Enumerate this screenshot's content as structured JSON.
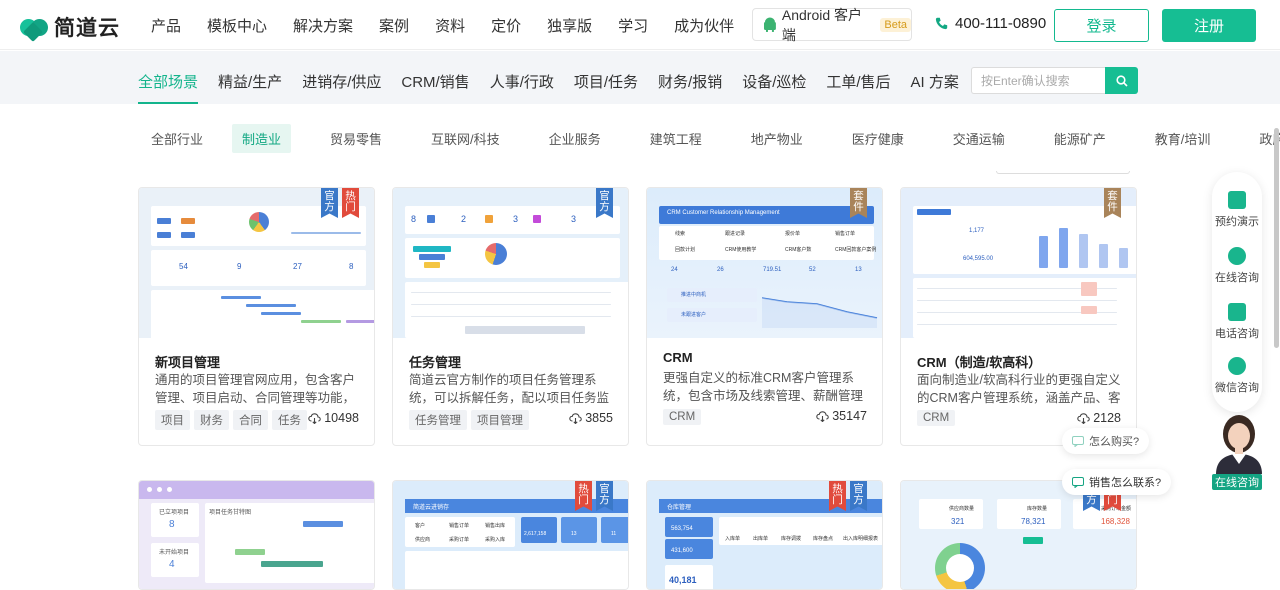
{
  "brand": {
    "name": "简道云"
  },
  "nav": {
    "links": [
      "产品",
      "模板中心",
      "解决方案",
      "案例",
      "资料",
      "定价",
      "独享版",
      "学习",
      "成为伙伴"
    ],
    "android_label": "Android 客户端",
    "beta": "Beta",
    "phone": "400-111-0890",
    "login": "登录",
    "signup": "注册"
  },
  "scenes": {
    "items": [
      "全部场景",
      "精益/生产",
      "进销存/供应",
      "CRM/销售",
      "人事/行政",
      "项目/任务",
      "财务/报销",
      "设备/巡检",
      "工单/售后",
      "AI 方案"
    ],
    "active_index": 0
  },
  "search": {
    "placeholder": "按Enter确认搜索",
    "value": ""
  },
  "industries": {
    "items": [
      "全部行业",
      "制造业",
      "贸易零售",
      "互联网/科技",
      "企业服务",
      "建筑工程",
      "地产物业",
      "医疗健康",
      "交通运输",
      "能源矿产",
      "教育/培训",
      "政府/公益"
    ],
    "active_index": 1
  },
  "cards": [
    {
      "title": "新项目管理",
      "desc": "通用的项目管理官网应用，包含客户管理、项目启动、合同管理等功能，让…",
      "tags": [
        "项目",
        "财务",
        "合同",
        "任务"
      ],
      "views": "10498",
      "ribbons": [
        "官方",
        "热门"
      ]
    },
    {
      "title": "任务管理",
      "desc": "简道云官方制作的项目任务管理系统，可以拆解任务，配以项目任务监控看…",
      "tags": [
        "任务管理",
        "项目管理"
      ],
      "views": "3855",
      "ribbons": [
        "官方"
      ]
    },
    {
      "title": "CRM",
      "desc": "更强自定义的标准CRM客户管理系统，包含市场及线索管理、薪酬管理等功能",
      "tags": [
        "CRM"
      ],
      "views": "35147",
      "ribbons": [
        "套件"
      ]
    },
    {
      "title": "CRM（制造/软高科）",
      "desc": "面向制造业/软高科行业的更强自定义的CRM客户管理系统，涵盖产品、客户…",
      "tags": [
        "CRM"
      ],
      "views": "2128",
      "ribbons": [
        "套件"
      ]
    }
  ],
  "row2_ribbons": [
    [],
    [
      "热门",
      "官方"
    ],
    [
      "热门",
      "官方"
    ],
    [
      "官方",
      "热门"
    ]
  ],
  "thumb_text": {
    "crm_title": "CRM Customer Relationship Management",
    "crm_labels": [
      "线索",
      "跟进记录",
      "报价单",
      "销售订单",
      "回款计划",
      "CRM使用教学",
      "CRM客户数",
      "CRM回款客户案例"
    ],
    "crm_stats": [
      "24",
      "26",
      "719.51",
      "52",
      "13"
    ],
    "crm_buttons": [
      "推进中商机",
      "未跟进客户"
    ],
    "crm2_value": "1,177",
    "crm2_total": "604,595.00",
    "pm_stats": [
      "54",
      "9",
      "27",
      "8"
    ],
    "task_stats": [
      "8",
      "2",
      "3",
      "3"
    ],
    "r2a": [
      "已立项项目",
      "8",
      "未开始项目",
      "4",
      "项目任务甘特图"
    ],
    "r2b_title": "简道云进销存",
    "r2b_buttons": [
      "客户",
      "销售订单",
      "销售出库",
      "供应商",
      "采购订单",
      "采购入库"
    ],
    "r2b_stats": [
      "2,617,158",
      "13",
      "11"
    ],
    "r2c_title": "仓库管理",
    "r2c_stats": [
      "563,754",
      "431,600",
      "40,181"
    ],
    "r2c_labels": [
      "入库单",
      "出库单",
      "库存调拨",
      "库存盘点",
      "出入库明细报表"
    ],
    "r2d_labels": [
      "供应商数量",
      "库存数量",
      "采购订单金额"
    ],
    "r2d_values": [
      "321",
      "78,321",
      "168,328"
    ]
  },
  "float": {
    "items": [
      "预约演示",
      "在线咨询",
      "电话咨询",
      "微信咨询"
    ],
    "online": "在线咨询"
  },
  "bubbles": [
    "怎么购买?",
    "销售怎么联系?"
  ],
  "colors": {
    "brand": "#16be93",
    "accent_blue": "#3a78c8",
    "accent_red": "#e14b3c"
  }
}
